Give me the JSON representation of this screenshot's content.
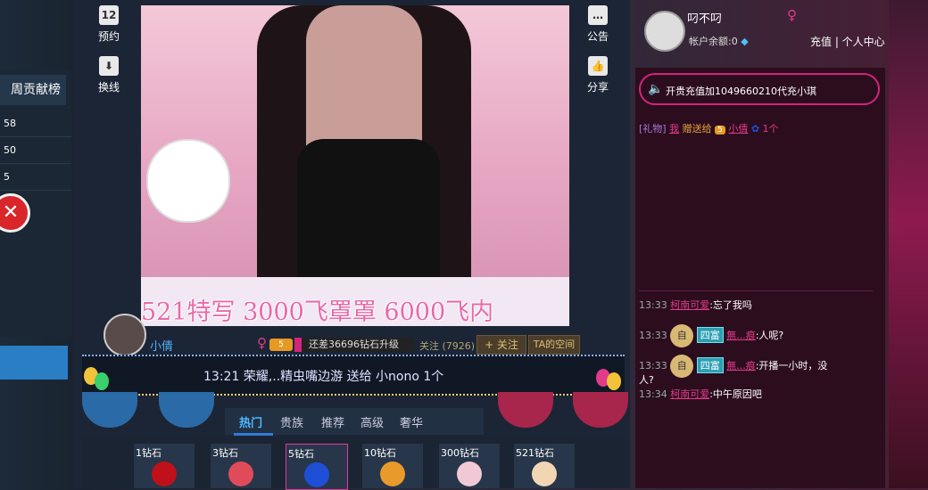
{
  "left_panel": {
    "title": "周贡献榜",
    "rows": [
      "58",
      "50",
      "5"
    ],
    "close_icon": "close-icon"
  },
  "toolbar_left": [
    {
      "label": "预约",
      "icon": "calendar-icon",
      "glyph": "12"
    },
    {
      "label": "换线",
      "icon": "download-arrow-icon",
      "glyph": "⬇"
    }
  ],
  "toolbar_right": [
    {
      "label": "公告",
      "icon": "speech-bubble-icon",
      "glyph": "…"
    },
    {
      "label": "分享",
      "icon": "thumbs-up-icon",
      "glyph": "👍"
    }
  ],
  "video": {
    "scroll_text": "521特写  3000飞罩罩  6000飞内"
  },
  "host": {
    "name": "小倩",
    "gender": "♀",
    "level": "5",
    "progress_text": "还差36696钻石升级",
    "progress_fraction": 0.06,
    "follow_count": "关注 (7926)",
    "follow_label": "+ 关注",
    "space_label": "TA的空间"
  },
  "ticker": {
    "text": "13:21  荣耀,..精虫嘴边游  送给  小nono    1个"
  },
  "tabs": [
    "热门",
    "贵族",
    "推荐",
    "高级",
    "奢华"
  ],
  "gifts": [
    {
      "label": "1钻石",
      "icon": "rose-icon",
      "color": "#c0101a"
    },
    {
      "label": "3钻石",
      "icon": "candy-icon",
      "color": "#e04b5a"
    },
    {
      "label": "5钻石",
      "icon": "blue-rose-icon",
      "color": "#1f4fd6"
    },
    {
      "label": "10钻石",
      "icon": "tart-icon",
      "color": "#e89a2a"
    },
    {
      "label": "300钻石",
      "icon": "lingerie-icon",
      "color": "#f1c9d6"
    },
    {
      "label": "521钻石",
      "icon": "cupid-icon",
      "color": "#f2d6b3"
    }
  ],
  "user": {
    "name": "叼不叼",
    "gender": "♀",
    "balance_text": "帐户余额:0",
    "recharge_text": "充值 | 个人中心"
  },
  "chat": {
    "notice": "开贵充值加1049660210代充小琪",
    "gift_message": {
      "prefix": "[礼物]",
      "sender": "我",
      "verb": "赠送给",
      "level": "5",
      "receiver": "小倩",
      "count": "1个"
    },
    "messages": [
      {
        "time": "13:33",
        "badge": "",
        "crest": "",
        "user": "柯南可爱",
        "text": ":忘了我吗"
      },
      {
        "time": "13:33",
        "badge": "四富",
        "crest": "自",
        "user": "無...痕",
        "text": ":人呢?"
      },
      {
        "time": "13:33",
        "badge": "四富",
        "crest": "自",
        "user": "無...痕",
        "text": ":开播一小时，没"
      },
      {
        "time": "",
        "badge": "",
        "crest": "",
        "user": "",
        "text": "人?"
      },
      {
        "time": "13:34",
        "badge": "",
        "crest": "",
        "user": "柯南可爱",
        "text": ":中午原因吧"
      }
    ]
  }
}
